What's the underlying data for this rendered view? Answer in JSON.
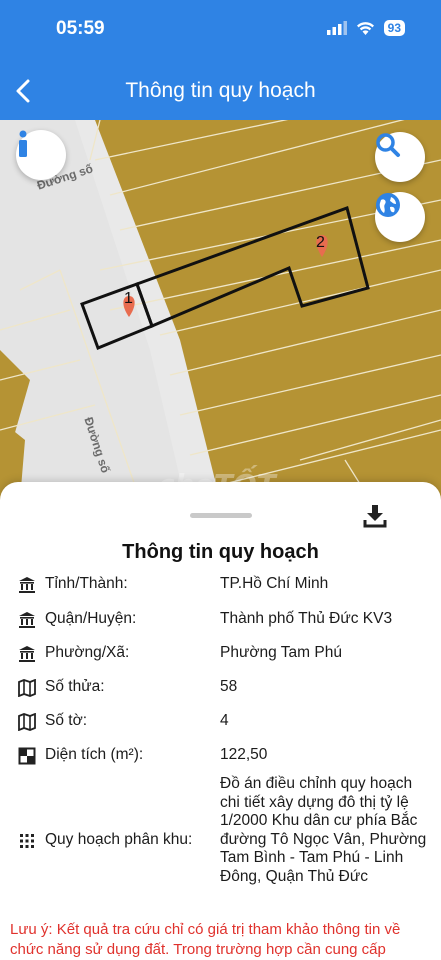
{
  "status_bar": {
    "time": "05:59",
    "battery": "93"
  },
  "header": {
    "title": "Thông tin quy hoạch"
  },
  "map": {
    "road_label_1": "Đường số",
    "road_label_2": "Đường số",
    "parcel_1_label": "1",
    "parcel_2_label": "2",
    "watermark": "chợTỐT",
    "fill_color": "#b59334"
  },
  "sheet": {
    "title": "Thông tin quy hoạch",
    "rows": [
      {
        "icon": "bank-icon",
        "label": "Tỉnh/Thành:",
        "value": "TP.Hồ Chí Minh"
      },
      {
        "icon": "bank-icon",
        "label": "Quận/Huyện:",
        "value": "Thành phố Thủ Đức KV3"
      },
      {
        "icon": "bank-icon",
        "label": "Phường/Xã:",
        "value": "Phường Tam Phú"
      },
      {
        "icon": "map-icon",
        "label": "Số thửa:",
        "value": "58"
      },
      {
        "icon": "map-icon",
        "label": "Số tờ:",
        "value": "4"
      },
      {
        "icon": "area-icon",
        "label": "Diện tích (m²):",
        "value": "122,50"
      },
      {
        "icon": "grid-dots-icon",
        "label": "Quy hoạch phân khu:",
        "value": "Đồ án điều chỉnh quy hoạch chi tiết xây dựng đô thị tỷ lệ 1/2000 Khu dân cư phía Bắc đường Tô Ngọc Vân, Phường Tam Bình - Tam Phú - Linh Đông, Quận Thủ Đức"
      }
    ],
    "note": "Lưu ý: Kết quả tra cứu chỉ có giá trị tham khảo thông tin về chức năng sử dụng đất. Trong trường hợp cần cung cấp"
  }
}
